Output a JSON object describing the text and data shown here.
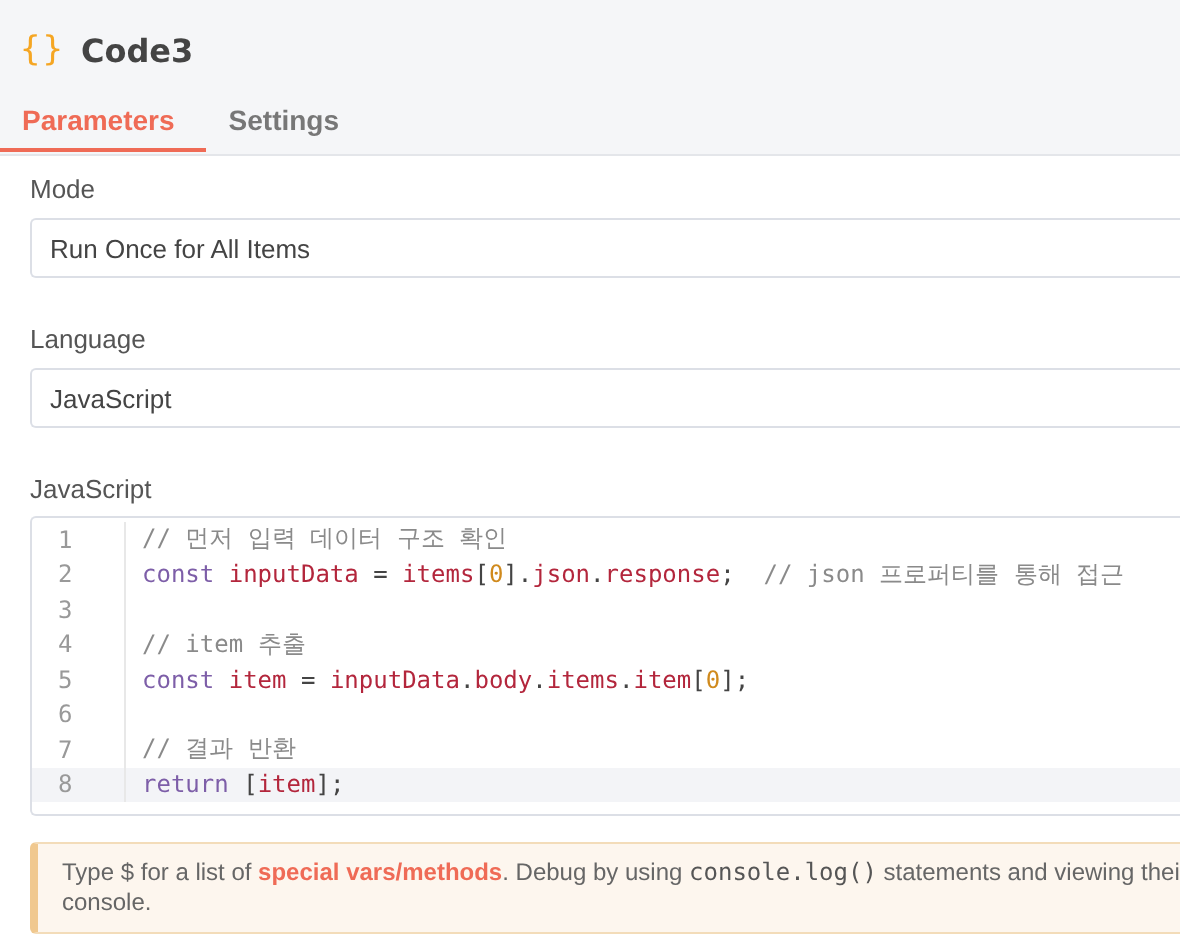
{
  "header": {
    "icon": "{}",
    "title": "Code3"
  },
  "tabs": [
    {
      "label": "Parameters",
      "selected": true
    },
    {
      "label": "Settings",
      "selected": false
    }
  ],
  "fields": [
    {
      "label": "Mode",
      "value": "Run Once for All Items"
    },
    {
      "label": "Language",
      "value": "JavaScript"
    }
  ],
  "editor": {
    "label": "JavaScript",
    "lines": [
      {
        "number": "1",
        "active": false,
        "tokens": [
          {
            "kind": "comment",
            "text": "// 먼저 입력 데이터 구조 확인"
          }
        ]
      },
      {
        "number": "2",
        "active": false,
        "tokens": [
          {
            "kind": "keyword",
            "text": "const "
          },
          {
            "kind": "variable",
            "text": "inputData"
          },
          {
            "kind": "punct",
            "text": " = "
          },
          {
            "kind": "variable",
            "text": "items"
          },
          {
            "kind": "punct",
            "text": "["
          },
          {
            "kind": "number",
            "text": "0"
          },
          {
            "kind": "punct",
            "text": "]."
          },
          {
            "kind": "variable",
            "text": "json"
          },
          {
            "kind": "punct",
            "text": "."
          },
          {
            "kind": "variable",
            "text": "response"
          },
          {
            "kind": "punct",
            "text": ";  "
          },
          {
            "kind": "comment",
            "text": "// json 프로퍼티를 통해 접근"
          }
        ]
      },
      {
        "number": "3",
        "active": false
      },
      {
        "number": "4",
        "active": false,
        "tokens": [
          {
            "kind": "comment",
            "text": "// item 추출"
          }
        ]
      },
      {
        "number": "5",
        "active": false,
        "tokens": [
          {
            "kind": "keyword",
            "text": "const "
          },
          {
            "kind": "variable",
            "text": "item"
          },
          {
            "kind": "punct",
            "text": " = "
          },
          {
            "kind": "variable",
            "text": "inputData"
          },
          {
            "kind": "punct",
            "text": "."
          },
          {
            "kind": "variable",
            "text": "body"
          },
          {
            "kind": "punct",
            "text": "."
          },
          {
            "kind": "variable",
            "text": "items"
          },
          {
            "kind": "punct",
            "text": "."
          },
          {
            "kind": "variable",
            "text": "item"
          },
          {
            "kind": "punct",
            "text": "["
          },
          {
            "kind": "number",
            "text": "0"
          },
          {
            "kind": "punct",
            "text": "];"
          }
        ]
      },
      {
        "number": "6",
        "active": false
      },
      {
        "number": "7",
        "active": false,
        "tokens": [
          {
            "kind": "comment",
            "text": "// 결과 반환"
          }
        ]
      },
      {
        "number": "8",
        "active": true,
        "tokens": [
          {
            "kind": "keyword",
            "text": "return "
          },
          {
            "kind": "punct",
            "text": "["
          },
          {
            "kind": "variable",
            "text": "item"
          },
          {
            "kind": "punct",
            "text": "];"
          }
        ]
      }
    ]
  },
  "notice": {
    "parts": [
      {
        "kind": "text",
        "text": "Type $ for a list of "
      },
      {
        "kind": "link",
        "text": "special vars/methods"
      },
      {
        "kind": "text",
        "text": ". Debug by using "
      },
      {
        "kind": "code",
        "text": "console.log()"
      },
      {
        "kind": "text",
        "text": " statements and viewing thei\nconsole."
      }
    ]
  }
}
